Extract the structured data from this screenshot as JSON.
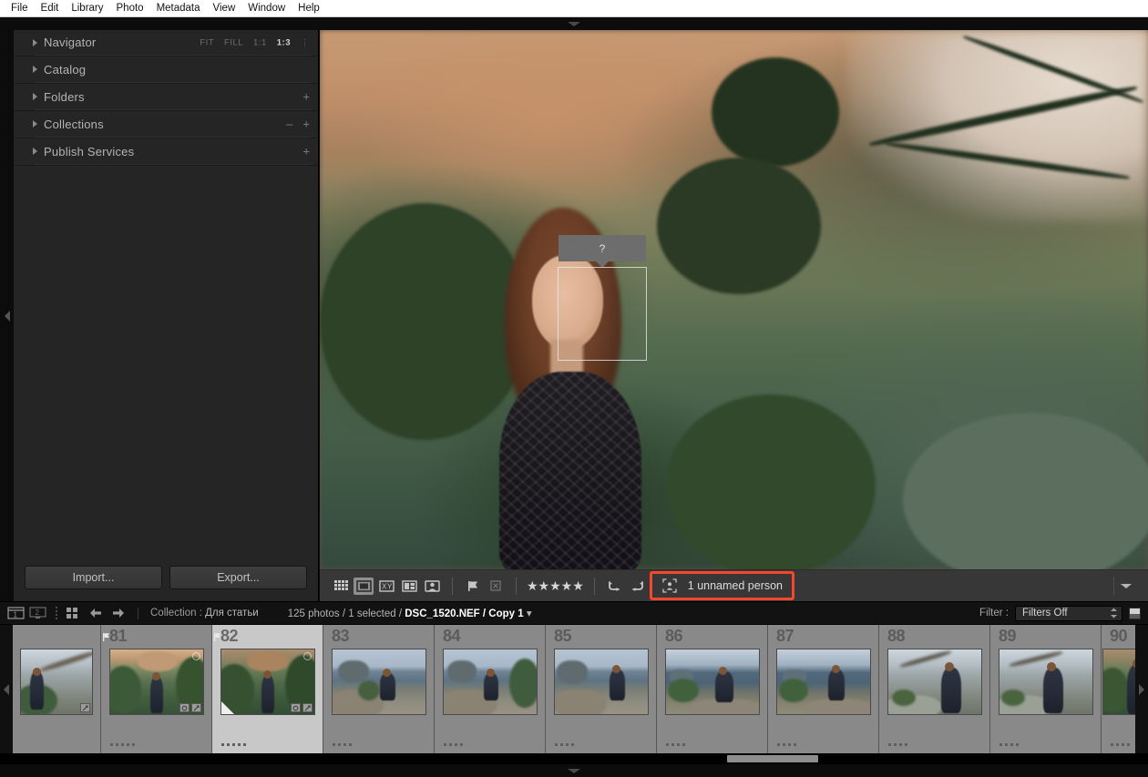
{
  "menubar": {
    "items": [
      "File",
      "Edit",
      "Library",
      "Photo",
      "Metadata",
      "View",
      "Window",
      "Help"
    ]
  },
  "left_panel": {
    "sections": [
      {
        "title": "Navigator",
        "adders": []
      },
      {
        "title": "Catalog",
        "adders": []
      },
      {
        "title": "Folders",
        "adders": [
          "+"
        ]
      },
      {
        "title": "Collections",
        "adders": [
          "–",
          "+"
        ]
      },
      {
        "title": "Publish Services",
        "adders": [
          "+"
        ]
      }
    ],
    "navigator_zoom": {
      "options": [
        "FIT",
        "FILL",
        "1:1",
        "1:3"
      ],
      "active": "1:3"
    },
    "import_label": "Import...",
    "export_label": "Export..."
  },
  "main_toolbar": {
    "view_icons": [
      "grid-view-icon",
      "loupe-view-icon",
      "compare-view-icon",
      "survey-view-icon",
      "people-view-icon"
    ],
    "flag_icons": [
      "flag-pick-icon",
      "flag-reject-icon"
    ],
    "rating_stars": "★★★★★",
    "rotate_icons": [
      "rotate-left-icon",
      "rotate-right-icon"
    ],
    "people_button_label": "1 unnamed person",
    "people_button_highlight_color": "#f5482b",
    "chevron": "chevron-down-icon"
  },
  "face_overlay": {
    "label": "?"
  },
  "filmstrip_bar": {
    "window_main_label": "1",
    "window_second_label": "2",
    "collection_label": "Collection :",
    "collection_name": "Для статьи",
    "count_text": "125 photos / 1 selected /",
    "file_name": "DSC_1520.NEF / Copy 1",
    "filter_label": "Filter :",
    "filter_value": "Filters Off"
  },
  "filmstrip": {
    "cells": [
      {
        "index": "",
        "scene": "sc-cliff",
        "rating": 0,
        "flag": false,
        "selected": false,
        "partial": true,
        "badges": 1
      },
      {
        "index": "81",
        "scene": "sc-forest",
        "rating": 5,
        "flag": true,
        "selected": false,
        "partial": false,
        "badges": 2
      },
      {
        "index": "82",
        "scene": "sc-forest2",
        "rating": 5,
        "flag": true,
        "selected": true,
        "partial": false,
        "badges": 2,
        "corner": true
      },
      {
        "index": "83",
        "scene": "sc-sea",
        "rating": 4,
        "flag": false,
        "selected": false,
        "partial": false,
        "badges": 0
      },
      {
        "index": "84",
        "scene": "sc-sea",
        "rating": 4,
        "flag": false,
        "selected": false,
        "partial": false,
        "badges": 0
      },
      {
        "index": "85",
        "scene": "sc-sea",
        "rating": 4,
        "flag": false,
        "selected": false,
        "partial": false,
        "badges": 0
      },
      {
        "index": "86",
        "scene": "sc-sea2",
        "rating": 4,
        "flag": false,
        "selected": false,
        "partial": false,
        "badges": 0
      },
      {
        "index": "87",
        "scene": "sc-sea2",
        "rating": 4,
        "flag": false,
        "selected": false,
        "partial": false,
        "badges": 0
      },
      {
        "index": "88",
        "scene": "sc-cliff",
        "rating": 4,
        "flag": false,
        "selected": false,
        "partial": false,
        "badges": 0
      },
      {
        "index": "89",
        "scene": "sc-cliff",
        "rating": 4,
        "flag": false,
        "selected": false,
        "partial": false,
        "badges": 0
      },
      {
        "index": "90",
        "scene": "sc-forest2",
        "rating": 4,
        "flag": false,
        "selected": false,
        "partial": false,
        "badges": 0,
        "partial_right": true
      }
    ]
  }
}
